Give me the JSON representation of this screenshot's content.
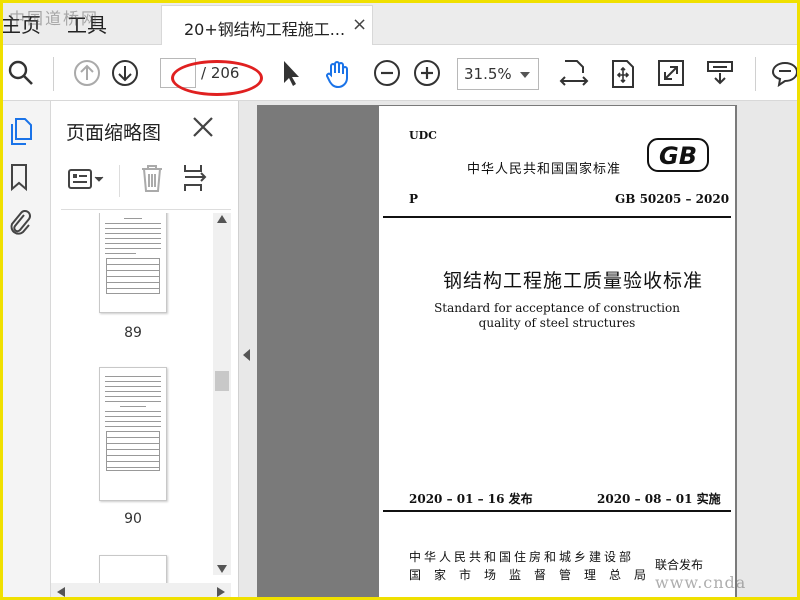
{
  "nav": {
    "home": "主页",
    "tools": "工具"
  },
  "tab": {
    "title": "20+钢结构工程施工...",
    "close": "×"
  },
  "toolbar": {
    "page_current": "",
    "page_total": "/ 206",
    "zoom": "31.5%"
  },
  "panel": {
    "title": "页面缩略图",
    "thumbnails": [
      {
        "page": "89"
      },
      {
        "page": "90"
      }
    ]
  },
  "document": {
    "udc": "UDC",
    "standard_org": "中华人民共和国国家标准",
    "logo_text": "GB",
    "p_label": "P",
    "code": "GB 50205 – 2020",
    "title_cn": "钢结构工程施工质量验收标准",
    "title_en_line1": "Standard for acceptance of construction",
    "title_en_line2": "quality of steel structures",
    "issue_date": "2020 – 01 – 16  发布",
    "implement_date": "2020 – 08 – 01  实施",
    "publisher_line1": "中华人民共和国住房和城乡建设部",
    "publisher_line2": "国家市场监督管理总局",
    "joint_release": "联合发布"
  },
  "watermarks": {
    "top_left": "中国道桥网",
    "bottom_right": "www.cnda"
  },
  "colors": {
    "annotation_oval": "#e02020",
    "hand_tool": "#1a73e8",
    "frame": "#f0e000"
  }
}
